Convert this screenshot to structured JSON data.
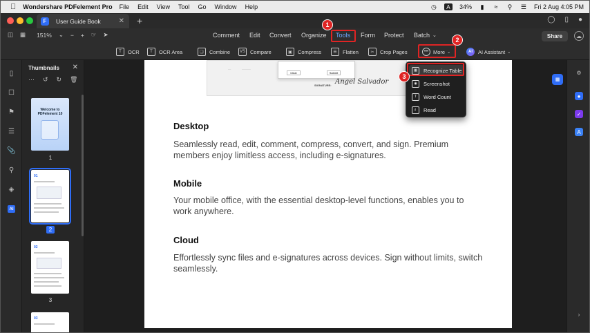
{
  "menubar": {
    "app_name": "Wondershare PDFelement Pro",
    "items": [
      "File",
      "Edit",
      "View",
      "Tool",
      "Go",
      "Window",
      "Help"
    ],
    "battery": "34%",
    "input_indicator": "A",
    "datetime": "Fri 2 Aug  4:05 PM"
  },
  "tab": {
    "title": "User Guide Book"
  },
  "toolbar": {
    "zoom": "151%",
    "menu": [
      "Comment",
      "Edit",
      "Convert",
      "Organize",
      "Tools",
      "Form",
      "Protect",
      "Batch"
    ],
    "active_menu": "Tools",
    "share_label": "Share"
  },
  "tools": [
    "OCR",
    "OCR Area",
    "Combine",
    "Compare",
    "Compress",
    "Flatten",
    "Crop Pages",
    "More",
    "AI Assistant"
  ],
  "more_menu": [
    "Recognize Table",
    "Screenshot",
    "Word Count",
    "Read"
  ],
  "thumbnails": {
    "title": "Thumbnails",
    "cover_title": "Welcome to PDFelement 10",
    "page2_heading": "01",
    "page3_heading": "02",
    "page4_heading": "03",
    "pages": [
      "1",
      "2",
      "3"
    ]
  },
  "document": {
    "signature_label": "SIGNATURE:",
    "signature": "Angel Salvador",
    "dialog_buttons": [
      "Clear",
      "Submit"
    ],
    "sections": [
      {
        "heading": "Desktop",
        "body": "Seamlessly read, edit, comment, compress, convert, and sign. Premium members enjoy limitless access, including e-signatures."
      },
      {
        "heading": "Mobile",
        "body": "Your mobile office, with the essential desktop-level functions, enables you to work anywhere."
      },
      {
        "heading": "Cloud",
        "body": "Effortlessly sync files and e-signatures across devices. Sign without limits, switch seamlessly."
      }
    ]
  },
  "annotations": [
    "1",
    "2",
    "3"
  ],
  "colors": {
    "accent": "#2f6df6",
    "annotation": "#e02424",
    "active_menu": "#6aa7ff"
  }
}
